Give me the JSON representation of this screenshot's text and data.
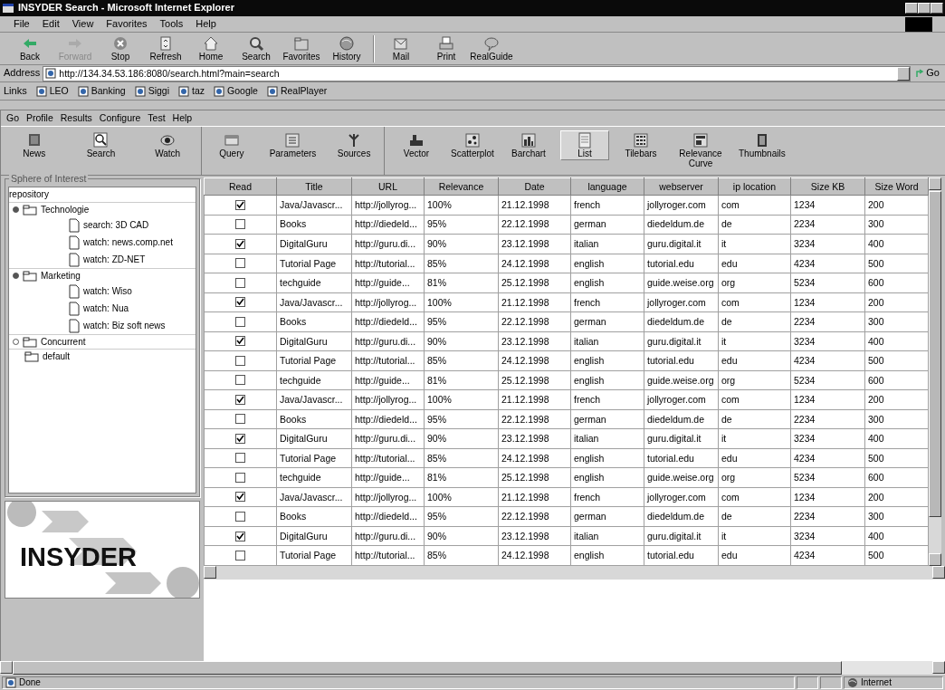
{
  "window": {
    "title": "INSYDER Search - Microsoft Internet Explorer"
  },
  "menu": [
    "File",
    "Edit",
    "View",
    "Favorites",
    "Tools",
    "Help"
  ],
  "toolbar": [
    {
      "label": "Back",
      "disabled": false
    },
    {
      "label": "Forward",
      "disabled": true
    },
    {
      "label": "Stop",
      "disabled": false
    },
    {
      "label": "Refresh",
      "disabled": false
    },
    {
      "label": "Home",
      "disabled": false
    },
    {
      "label": "Search",
      "disabled": false
    },
    {
      "label": "Favorites",
      "disabled": false
    },
    {
      "label": "History",
      "disabled": false
    },
    {
      "label": "Mail",
      "disabled": false
    },
    {
      "label": "Print",
      "disabled": false
    },
    {
      "label": "RealGuide",
      "disabled": false
    }
  ],
  "address": {
    "label": "Address",
    "value": "http://134.34.53.186:8080/search.html?main=search",
    "go": "Go"
  },
  "links": {
    "label": "Links",
    "items": [
      "LEO",
      "Banking",
      "Siggi",
      "taz",
      "Google",
      "RealPlayer"
    ]
  },
  "app": {
    "menu": [
      "Go",
      "Profile",
      "Results",
      "Configure",
      "Test",
      "Help"
    ],
    "toolbar": [
      {
        "buttons": [
          {
            "label": "News",
            "selected": false
          },
          {
            "label": "Search",
            "selected": false
          },
          {
            "label": "Watch",
            "selected": false
          }
        ]
      },
      {
        "buttons": [
          {
            "label": "Query",
            "selected": false
          },
          {
            "label": "Parameters",
            "selected": false
          },
          {
            "label": "Sources",
            "selected": false
          }
        ]
      },
      {
        "buttons": [
          {
            "label": "Vector",
            "selected": false
          },
          {
            "label": "Scatterplot",
            "selected": false
          },
          {
            "label": "Barchart",
            "selected": false
          },
          {
            "label": "List",
            "selected": true
          },
          {
            "label": "Tilebars",
            "selected": false
          },
          {
            "label": "Relevance Curve",
            "selected": false
          },
          {
            "label": "Thumbnails",
            "selected": false
          }
        ]
      }
    ]
  },
  "sidebar": {
    "title": "Sphere of Interest",
    "tree": {
      "label": "repository",
      "children": [
        {
          "label": "Technologie",
          "kind": "group",
          "expanded": true,
          "children": [
            {
              "label": "search: 3D CAD",
              "kind": "query"
            },
            {
              "label": "watch: news.comp.net",
              "kind": "query"
            },
            {
              "label": "watch: ZD-NET",
              "kind": "query"
            }
          ]
        },
        {
          "label": "Marketing",
          "kind": "group",
          "expanded": true,
          "children": [
            {
              "label": "watch: Wiso",
              "kind": "query"
            },
            {
              "label": "watch: Nua",
              "kind": "query"
            },
            {
              "label": "watch: Biz soft news",
              "kind": "query"
            }
          ]
        },
        {
          "label": "Concurrent",
          "kind": "group",
          "expanded": false
        },
        {
          "label": "default",
          "kind": "folder"
        }
      ]
    },
    "logo": {
      "text": "INSYDER"
    }
  },
  "results": {
    "columns": [
      "Read",
      "Title",
      "URL",
      "Relevance",
      "Date",
      "language",
      "webserver",
      "ip location",
      "Size KB",
      "Size Word"
    ],
    "rows": [
      {
        "read": true,
        "cells": [
          "",
          "Java/Javascr...",
          "http://jollyrog...",
          "100%",
          "21.12.1998",
          "french",
          "jollyroger.com",
          "com",
          "1234",
          "200"
        ]
      },
      {
        "read": false,
        "cells": [
          "",
          "Books",
          "http://diedeld...",
          "95%",
          "22.12.1998",
          "german",
          "diedeldum.de",
          "de",
          "2234",
          "300"
        ]
      },
      {
        "read": true,
        "cells": [
          "",
          "DigitalGuru",
          "http://guru.di...",
          "90%",
          "23.12.1998",
          "italian",
          "guru.digital.it",
          "it",
          "3234",
          "400"
        ]
      },
      {
        "read": false,
        "cells": [
          "",
          "Tutorial Page",
          "http://tutorial...",
          "85%",
          "24.12.1998",
          "english",
          "tutorial.edu",
          "edu",
          "4234",
          "500"
        ]
      },
      {
        "read": false,
        "cells": [
          "",
          "techguide",
          "http://guide...",
          "81%",
          "25.12.1998",
          "english",
          "guide.weise.org",
          "org",
          "5234",
          "600"
        ]
      },
      {
        "read": true,
        "cells": [
          "",
          "Java/Javascr...",
          "http://jollyrog...",
          "100%",
          "21.12.1998",
          "french",
          "jollyroger.com",
          "com",
          "1234",
          "200"
        ]
      },
      {
        "read": false,
        "cells": [
          "",
          "Books",
          "http://diedeld...",
          "95%",
          "22.12.1998",
          "german",
          "diedeldum.de",
          "de",
          "2234",
          "300"
        ]
      },
      {
        "read": true,
        "cells": [
          "",
          "DigitalGuru",
          "http://guru.di...",
          "90%",
          "23.12.1998",
          "italian",
          "guru.digital.it",
          "it",
          "3234",
          "400"
        ]
      },
      {
        "read": false,
        "cells": [
          "",
          "Tutorial Page",
          "http://tutorial...",
          "85%",
          "24.12.1998",
          "english",
          "tutorial.edu",
          "edu",
          "4234",
          "500"
        ]
      },
      {
        "read": false,
        "cells": [
          "",
          "techguide",
          "http://guide...",
          "81%",
          "25.12.1998",
          "english",
          "guide.weise.org",
          "org",
          "5234",
          "600"
        ]
      },
      {
        "read": true,
        "cells": [
          "",
          "Java/Javascr...",
          "http://jollyrog...",
          "100%",
          "21.12.1998",
          "french",
          "jollyroger.com",
          "com",
          "1234",
          "200"
        ]
      },
      {
        "read": false,
        "cells": [
          "",
          "Books",
          "http://diedeld...",
          "95%",
          "22.12.1998",
          "german",
          "diedeldum.de",
          "de",
          "2234",
          "300"
        ]
      },
      {
        "read": true,
        "cells": [
          "",
          "DigitalGuru",
          "http://guru.di...",
          "90%",
          "23.12.1998",
          "italian",
          "guru.digital.it",
          "it",
          "3234",
          "400"
        ]
      },
      {
        "read": false,
        "cells": [
          "",
          "Tutorial Page",
          "http://tutorial...",
          "85%",
          "24.12.1998",
          "english",
          "tutorial.edu",
          "edu",
          "4234",
          "500"
        ]
      },
      {
        "read": false,
        "cells": [
          "",
          "techguide",
          "http://guide...",
          "81%",
          "25.12.1998",
          "english",
          "guide.weise.org",
          "org",
          "5234",
          "600"
        ]
      },
      {
        "read": true,
        "cells": [
          "",
          "Java/Javascr...",
          "http://jollyrog...",
          "100%",
          "21.12.1998",
          "french",
          "jollyroger.com",
          "com",
          "1234",
          "200"
        ]
      },
      {
        "read": false,
        "cells": [
          "",
          "Books",
          "http://diedeld...",
          "95%",
          "22.12.1998",
          "german",
          "diedeldum.de",
          "de",
          "2234",
          "300"
        ]
      },
      {
        "read": true,
        "cells": [
          "",
          "DigitalGuru",
          "http://guru.di...",
          "90%",
          "23.12.1998",
          "italian",
          "guru.digital.it",
          "it",
          "3234",
          "400"
        ]
      },
      {
        "read": false,
        "cells": [
          "",
          "Tutorial Page",
          "http://tutorial...",
          "85%",
          "24.12.1998",
          "english",
          "tutorial.edu",
          "edu",
          "4234",
          "500"
        ]
      }
    ]
  },
  "status_bar": {
    "text": "Done",
    "zone": "Internet"
  }
}
